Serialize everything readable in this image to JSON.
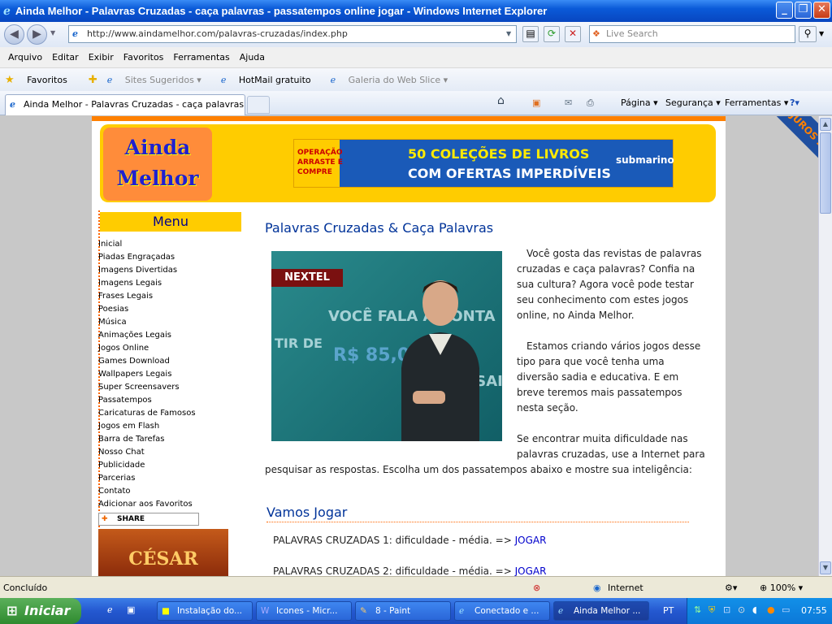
{
  "window": {
    "title": "Ainda Melhor - Palavras Cruzadas - caça palavras - passatempos online jogar - Windows Internet Explorer"
  },
  "address_bar": {
    "url": "http://www.aindamelhor.com/palavras-cruzadas/index.php",
    "search_placeholder": "Live Search"
  },
  "menu_bar": [
    "Arquivo",
    "Editar",
    "Exibir",
    "Favoritos",
    "Ferramentas",
    "Ajuda"
  ],
  "favorites_bar": {
    "favorites_label": "Favoritos",
    "items": [
      "Sites Sugeridos ▾",
      "HotMail gratuito",
      "Galeria do Web Slice ▾"
    ]
  },
  "tabs": {
    "active_label": "Ainda Melhor - Palavras Cruzadas - caça palavras - pa...",
    "commands": [
      "Página ▾",
      "Segurança ▾",
      "Ferramentas ▾"
    ]
  },
  "page": {
    "logo_line1": "Ainda",
    "logo_line2": "Melhor",
    "banner_line1": "50 COLEÇÕES DE LIVROS",
    "banner_line2": "COM OFERTAS IMPERDÍVEIS",
    "banner_promo": "OPERAÇÃO ARRASTE E COMPRE",
    "banner_brand": "submarino",
    "ribbon": "JUROS ZERO super legal",
    "menu_title": "Menu",
    "menu_items": [
      "Inicial",
      "Piadas Engraçadas",
      "Imagens Divertidas",
      "Imagens Legais",
      "Frases Legais",
      "Poesias",
      "Música",
      "Animações Legais",
      "Jogos Online",
      "Games Download",
      "Wallpapers Legais",
      "Super Screensavers",
      "Passatempos",
      "Caricaturas de Famosos",
      "Jogos em Flash",
      "Barra de Tarefas",
      "Nosso Chat",
      "Publicidade",
      "Parcerias",
      "Contato",
      "Adicionar aos Favoritos"
    ],
    "share_label": "SHARE",
    "ad2_text": "CÉSAR",
    "heading": "Palavras Cruzadas & Caça Palavras",
    "photo": {
      "brand": "NEXTEL",
      "line1": "VOCÊ FALA À VONTA",
      "line2": "TIR DE",
      "price": "R$ 85,00",
      "line3": "MENSAI"
    },
    "para1": "Você gosta das revistas de palavras cruzadas e caça palavras? Confia na sua cultura? Agora você pode testar seu conhecimento com estes jogos online, no Ainda Melhor.",
    "para2": "Estamos criando vários jogos desse tipo para que você tenha uma diversão sadia e educativa. E em breve teremos mais passatempos nesta seção.",
    "para3a": "Se encontrar muita dificuldade nas palavras cruzadas, use a Internet para",
    "para3b": "pesquisar as respostas. Escolha um dos passatempos abaixo e mostre sua inteligência:",
    "section_title": "Vamos Jogar",
    "games": [
      {
        "text": "PALAVRAS CRUZADAS 1: dificuldade - média. => ",
        "link": "JOGAR"
      },
      {
        "text": "PALAVRAS CRUZADAS 2: dificuldade - média. => ",
        "link": "JOGAR"
      }
    ]
  },
  "status_bar": {
    "status": "Concluído",
    "zone": "Internet",
    "zoom": "100%"
  },
  "taskbar": {
    "start": "Iniciar",
    "tasks": [
      "Instalação do...",
      "Icones - Micr...",
      "8 - Paint",
      "Conectado e ...",
      "Ainda Melhor ..."
    ],
    "language": "PT",
    "clock": "07:55"
  }
}
